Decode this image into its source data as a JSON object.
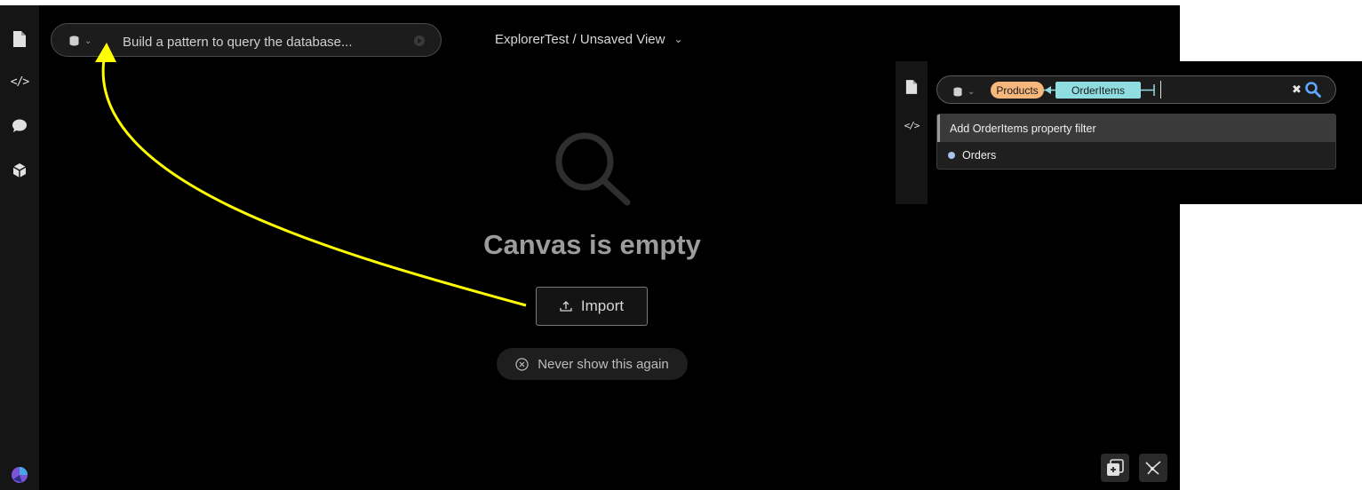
{
  "query_bar": {
    "placeholder": "Build a pattern to query the database...",
    "db_icon": "database-icon",
    "run_icon": "play-icon"
  },
  "header": {
    "breadcrumb": "ExplorerTest / Unsaved View"
  },
  "sidebar": {
    "items": [
      {
        "name": "document-icon"
      },
      {
        "name": "code-icon",
        "glyph": "</>"
      },
      {
        "name": "chat-icon"
      },
      {
        "name": "cube-icon"
      }
    ],
    "logo": "app-logo-icon"
  },
  "canvas": {
    "empty_title": "Canvas is empty",
    "import_label": "Import",
    "never_show_label": "Never show this again"
  },
  "inset": {
    "chips": {
      "products": "Products",
      "orderitems": "OrderItems"
    },
    "suggestions": {
      "filter": "Add OrderItems property filter",
      "orders": "Orders"
    },
    "code_glyph": "</>"
  },
  "colors": {
    "background": "#000000",
    "annotation_arrow": "#ffff00",
    "chip_products": "#f5b77c",
    "chip_orderitems": "#8fdde0",
    "search_icon": "#5fa8ff",
    "orders_dot": "#a9c4ec"
  }
}
